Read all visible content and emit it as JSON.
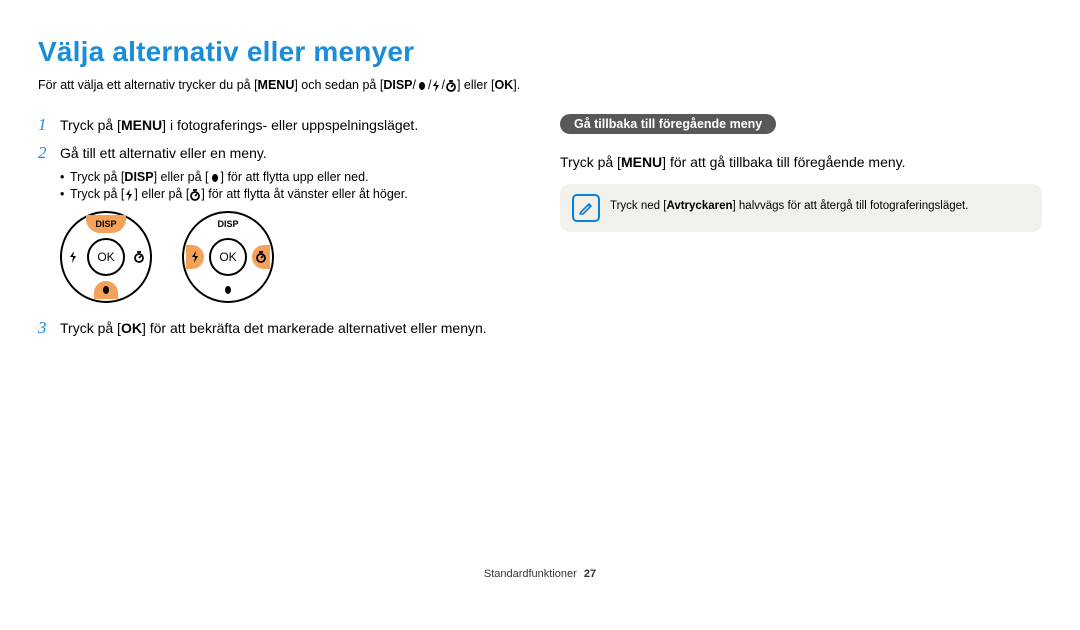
{
  "title": "Välja alternativ eller menyer",
  "intro": {
    "t1": "För att välja ett alternativ trycker du på [",
    "menu": "MENU",
    "t2": "] och sedan på [",
    "disp": "DISP",
    "sep": "/",
    "t3": "] eller [",
    "ok": "OK",
    "t4": "]."
  },
  "step1": {
    "n": "1",
    "t1": "Tryck på [",
    "menu": "MENU",
    "t2": "] i fotograferings- eller uppspelningsläget."
  },
  "step2": {
    "n": "2",
    "body": "Gå till ett alternativ eller en meny.",
    "b1": {
      "t1": "Tryck på [",
      "disp": "DISP",
      "t2": "] eller på [",
      "t3": "] för att flytta upp eller ned."
    },
    "b2": {
      "t1": "Tryck på [",
      "t2": "] eller på [",
      "t3": "] för att flytta åt vänster eller åt höger."
    }
  },
  "step3": {
    "n": "3",
    "t1": "Tryck på [",
    "ok": "OK",
    "t2": "] för att bekräfta det markerade alternativet eller menyn."
  },
  "dial": {
    "disp": "DISP",
    "ok": "OK"
  },
  "right": {
    "pill": "Gå tillbaka till föregående meny",
    "p": {
      "t1": "Tryck på [",
      "menu": "MENU",
      "t2": "] för att gå tillbaka till föregående meny."
    },
    "note": {
      "t1": "Tryck ned [",
      "b": "Avtryckaren",
      "t2": "] halvvägs för att återgå till fotograferingsläget."
    }
  },
  "footer": {
    "label": "Standardfunktioner",
    "page": "27"
  }
}
